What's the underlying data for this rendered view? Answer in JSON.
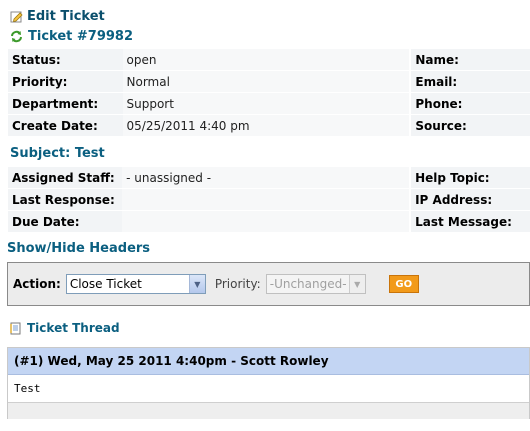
{
  "edit_ticket": "Edit Ticket",
  "ticket_title": "Ticket #79982",
  "info": [
    {
      "label": "Status:",
      "value": "open",
      "right_label": "Name:"
    },
    {
      "label": "Priority:",
      "value": "Normal",
      "right_label": "Email:"
    },
    {
      "label": "Department:",
      "value": "Support",
      "right_label": "Phone:"
    },
    {
      "label": "Create Date:",
      "value": "05/25/2011 4:40 pm",
      "right_label": "Source:"
    }
  ],
  "subject": "Subject: Test",
  "info2": [
    {
      "label": "Assigned Staff:",
      "value": "- unassigned -",
      "right_label": "Help Topic:"
    },
    {
      "label": "Last Response:",
      "value": "",
      "right_label": "IP Address:"
    },
    {
      "label": "Due Date:",
      "value": "",
      "right_label": "Last Message:"
    }
  ],
  "show_hide_headers": "Show/Hide Headers",
  "action_bar": {
    "action_label": "Action:",
    "action_selected": "Close Ticket",
    "priority_label": "Priority:",
    "priority_selected": "-Unchanged-",
    "go_label": "GO"
  },
  "thread_link": "Ticket Thread",
  "thread": {
    "header": "(#1) Wed, May 25 2011 4:40pm - Scott Rowley",
    "body": "Test"
  },
  "colors": {
    "heading": "#0b5f80",
    "thread_header_bg": "#c3d5f3",
    "go_button": "#f29a1a"
  }
}
